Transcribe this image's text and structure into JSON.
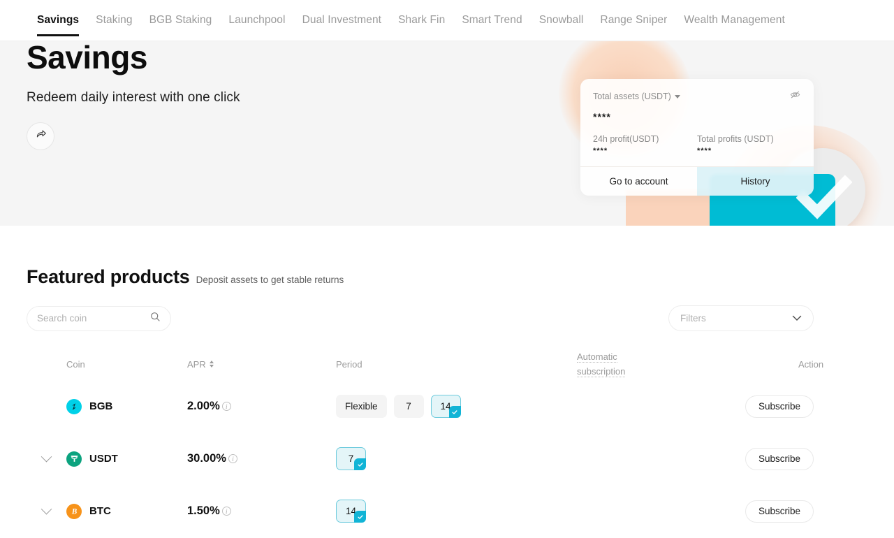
{
  "nav": {
    "tabs": [
      {
        "label": "Savings",
        "active": true
      },
      {
        "label": "Staking",
        "active": false
      },
      {
        "label": "BGB Staking",
        "active": false
      },
      {
        "label": "Launchpool",
        "active": false
      },
      {
        "label": "Dual Investment",
        "active": false
      },
      {
        "label": "Shark Fin",
        "active": false
      },
      {
        "label": "Smart Trend",
        "active": false
      },
      {
        "label": "Snowball",
        "active": false
      },
      {
        "label": "Range Sniper",
        "active": false
      },
      {
        "label": "Wealth Management",
        "active": false
      }
    ]
  },
  "hero": {
    "title": "Savings",
    "subtitle": "Redeem daily interest with one click",
    "share_icon": "share-icon"
  },
  "account_card": {
    "total_assets_label": "Total assets (USDT)",
    "total_assets_value": "****",
    "hide_icon": "eye-off-icon",
    "dropdown_icon": "chevron-down-icon",
    "profit_24h_label": "24h profit(USDT)",
    "profit_24h_value": "****",
    "total_profits_label": "Total profits (USDT)",
    "total_profits_value": "****",
    "go_to_account_label": "Go to account",
    "history_label": "History"
  },
  "featured": {
    "title": "Featured products",
    "subtitle": "Deposit assets to get stable returns",
    "search": {
      "placeholder": "Search coin",
      "value": "",
      "icon": "search-icon"
    },
    "filters": {
      "label": "Filters",
      "icon": "chevron-down-icon"
    },
    "columns": {
      "coin": "Coin",
      "apr": "APR",
      "period": "Period",
      "automatic_subscription": "Automatic subscription",
      "action": "Action"
    },
    "rows": [
      {
        "coin": "BGB",
        "icon": "bgb-coin-icon",
        "icon_color": "#00d1e8",
        "apr": "2.00%",
        "expandable": false,
        "periods": [
          {
            "label": "Flexible",
            "selected": false
          },
          {
            "label": "7",
            "selected": false
          },
          {
            "label": "14",
            "selected": true
          }
        ],
        "action": "Subscribe"
      },
      {
        "coin": "USDT",
        "icon": "usdt-coin-icon",
        "icon_color": "#0ca37f",
        "apr": "30.00%",
        "expandable": true,
        "periods": [
          {
            "label": "7",
            "selected": true
          }
        ],
        "action": "Subscribe"
      },
      {
        "coin": "BTC",
        "icon": "btc-coin-icon",
        "icon_color": "#f7931a",
        "apr": "1.50%",
        "expandable": true,
        "periods": [
          {
            "label": "14",
            "selected": true
          }
        ],
        "action": "Subscribe"
      }
    ]
  },
  "colors": {
    "accent_cyan": "#00bcd4",
    "selected_chip_border": "#6ecbdd",
    "selected_chip_bg": "#e4f5f8",
    "check_badge": "#11b4d6",
    "hero_bg": "#f5f5f5",
    "peach": "#fad3bb"
  }
}
